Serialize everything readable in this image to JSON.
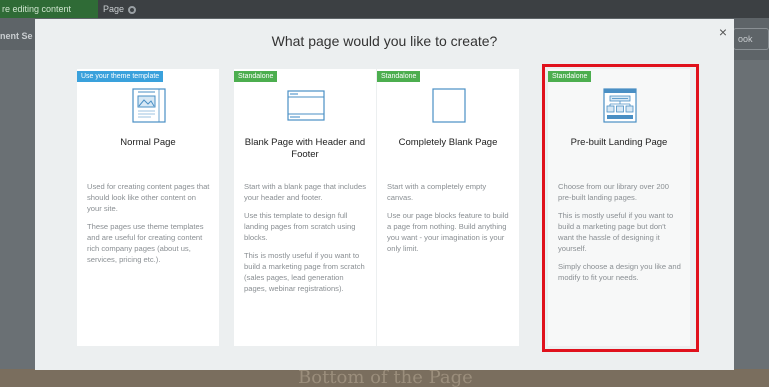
{
  "background": {
    "editing_label": "re editing content",
    "page_label": "Page",
    "left_label": "nent Se",
    "right_button": "ook",
    "bottom_text": "Bottom of the Page"
  },
  "modal": {
    "title": "What page would you like to create?",
    "close_label": "×",
    "cards": [
      {
        "badge": "Use your theme template",
        "title": "Normal Page",
        "paragraphs": [
          "Used for creating content pages that should look like other content on your site.",
          "These pages use theme templates and are useful for creating content rich company pages (about us, services, pricing etc.)."
        ]
      },
      {
        "badge": "Standalone",
        "title": "Blank Page with Header and Footer",
        "paragraphs": [
          "Start with a blank page that includes your header and footer.",
          "Use this template to design full landing pages from scratch using blocks.",
          "This is mostly useful if you want to build a marketing page from scratch (sales pages, lead generation pages, webinar registrations)."
        ]
      },
      {
        "badge": "Standalone",
        "title": "Completely Blank Page",
        "paragraphs": [
          "Start with a completely empty canvas.",
          "Use our page blocks feature to build a page from nothing. Build anything you want - your imagination is your only limit."
        ]
      },
      {
        "badge": "Standalone",
        "title": "Pre-built Landing Page",
        "paragraphs": [
          "Choose from our library over 200 pre-built landing pages.",
          "This is mostly useful if you want to build a marketing page but don't want the hassle of designing it yourself.",
          "Simply choose a design you like and modify to fit your needs."
        ]
      }
    ]
  },
  "colors": {
    "badge_blue": "#3aa1dc",
    "badge_green": "#4cae4f",
    "icon_blue": "#4a8fc4",
    "highlight_red": "#e0111c"
  },
  "icons": [
    "document-image-icon",
    "browser-window-icon",
    "blank-page-icon",
    "landing-page-icon",
    "close-icon",
    "gear-icon"
  ]
}
